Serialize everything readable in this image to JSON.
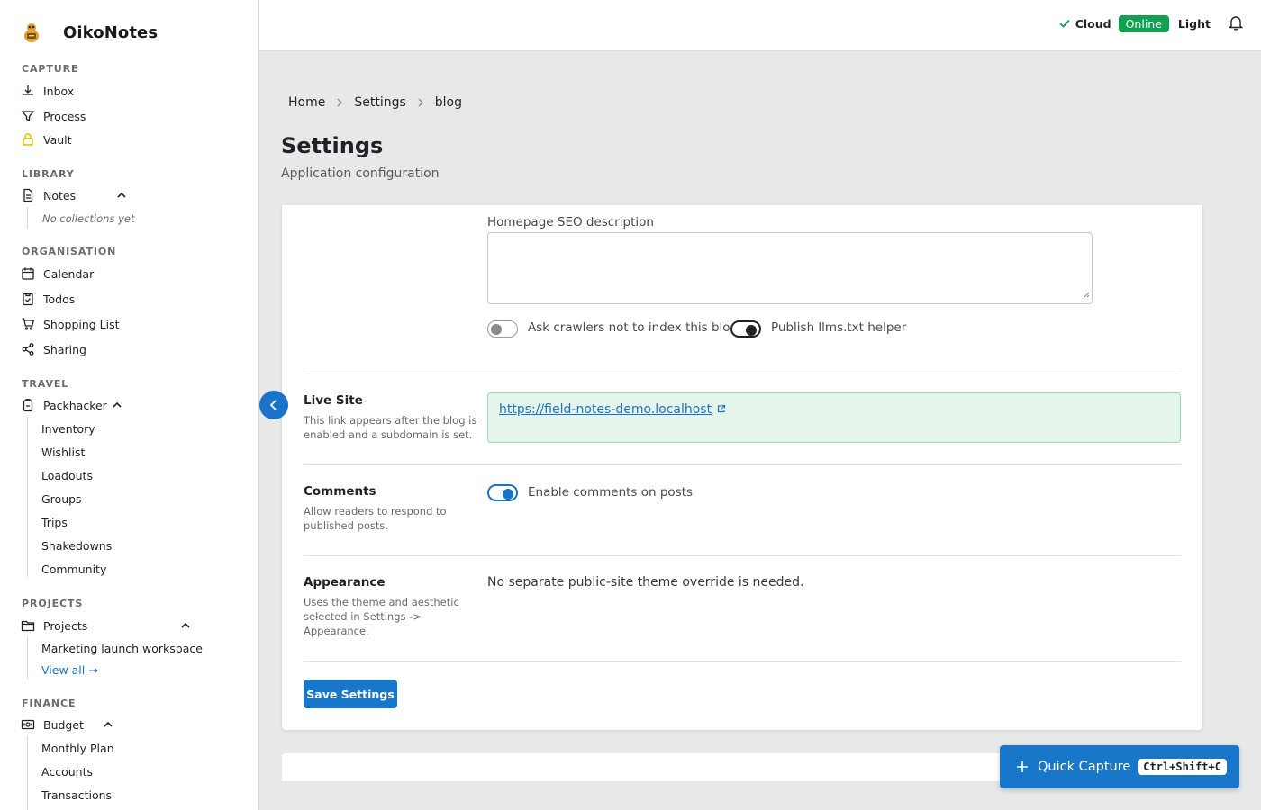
{
  "app": {
    "name": "OikoNotes"
  },
  "header": {
    "cloud_label": "Cloud",
    "online_label": "Online",
    "theme_label": "Light"
  },
  "sidebar": {
    "capture": {
      "title": "CAPTURE",
      "items": [
        "Inbox",
        "Process",
        "Vault"
      ]
    },
    "library": {
      "title": "LIBRARY",
      "notes_label": "Notes",
      "empty_text": "No collections yet"
    },
    "organisation": {
      "title": "ORGANISATION",
      "items": [
        "Calendar",
        "Todos",
        "Shopping List",
        "Sharing"
      ]
    },
    "travel": {
      "title": "TRAVEL",
      "parent_label": "Packhacker",
      "children": [
        "Inventory",
        "Wishlist",
        "Loadouts",
        "Groups",
        "Trips",
        "Shakedowns",
        "Community"
      ]
    },
    "projects": {
      "title": "PROJECTS",
      "parent_label": "Projects",
      "children": [
        "Marketing launch workspace"
      ],
      "view_all": "View all →"
    },
    "finance": {
      "title": "FINANCE",
      "parent_label": "Budget",
      "children": [
        "Monthly Plan",
        "Accounts",
        "Transactions"
      ]
    }
  },
  "breadcrumb": [
    "Home",
    "Settings",
    "blog"
  ],
  "page": {
    "title": "Settings",
    "subtitle": "Application configuration"
  },
  "form": {
    "seo_label": "Homepage SEO description",
    "seo_value": "",
    "noindex_label": "Ask crawlers not to index this blog",
    "noindex_on": false,
    "llms_label": "Publish llms.txt helper",
    "llms_on": true,
    "live_site": {
      "title": "Live Site",
      "desc": "This link appears after the blog is enabled and a subdomain is set.",
      "url": "https://field-notes-demo.localhost"
    },
    "comments": {
      "title": "Comments",
      "desc": "Allow readers to respond to published posts.",
      "toggle_label": "Enable comments on posts",
      "on": true
    },
    "appearance": {
      "title": "Appearance",
      "desc": "Uses the theme and aesthetic selected in Settings -> Appearance.",
      "text": "No separate public-site theme override is needed."
    },
    "save_label": "Save Settings"
  },
  "quick_capture": {
    "label": "Quick Capture",
    "shortcut": "Ctrl+Shift+C"
  }
}
